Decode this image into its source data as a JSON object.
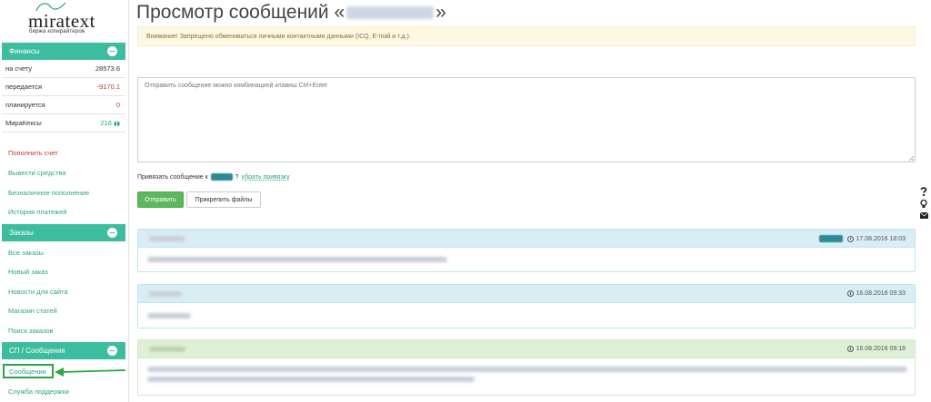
{
  "logo": {
    "name": "miratext",
    "subtitle": "биржа копирайтеров"
  },
  "sidebar": {
    "finance": {
      "title": "Финансы",
      "rows": [
        {
          "label": "на счету",
          "value": "28573.6"
        },
        {
          "label": "передается",
          "value": "-9170.1"
        },
        {
          "label": "планируется",
          "value": "0"
        },
        {
          "label": "МираКексы",
          "value": "216"
        }
      ],
      "links": [
        "Пополнить счет",
        "Вывести средства",
        "Безналичное пополнение",
        "История платежей"
      ]
    },
    "orders": {
      "title": "Заказы",
      "links": [
        "Все заказы",
        "Новый заказ",
        "Новости для сайта",
        "Магазин статей",
        "Поиск заказов"
      ]
    },
    "messages": {
      "title": "СП / Сообщения",
      "links": [
        "Сообщения",
        "Служба поддержки"
      ]
    }
  },
  "main": {
    "title_prefix": "Просмотр сообщений «",
    "title_suffix": "»",
    "warning": "Внимание! Запрещено обмениваться личными контактными данными (ICQ, E-mail и т.д.).",
    "message_placeholder": "Отправить сообщение можно комбинацией клавиш Ctrl+Enter",
    "bind_label": "Привязать сообщение к",
    "bind_question": "?",
    "unbind_link": "убрать привязку",
    "send_button": "Отправить",
    "attach_button": "Прикрепить файлы"
  },
  "messages": [
    {
      "date": "17.08.2016 18:03",
      "style": "blue"
    },
    {
      "date": "16.08.2016 09:33",
      "style": "blue"
    },
    {
      "date": "16.08.2016 09:18",
      "style": "green"
    }
  ],
  "icons": {
    "help": "question-icon",
    "idea": "lightbulb-icon",
    "mail": "envelope-icon",
    "gift": "gift-icon",
    "clock": "clock-icon"
  },
  "colors": {
    "accent": "#3dbda0",
    "link": "#2aa38a",
    "negative": "#c0392b",
    "send": "#5cb85c",
    "highlight": "#28a745"
  }
}
